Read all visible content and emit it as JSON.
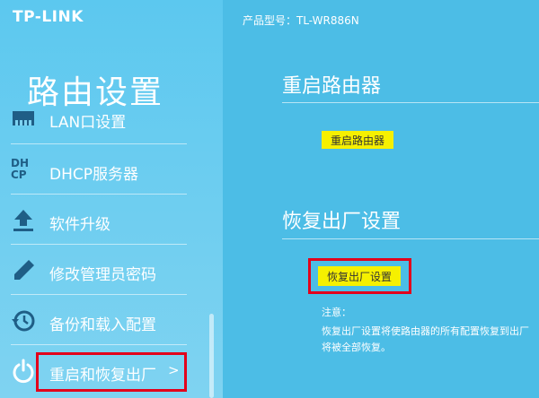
{
  "header": {
    "logo": "TP-LINK",
    "model_label": "产品型号：TL-WR886N"
  },
  "sidebar": {
    "title": "路由设置",
    "items": [
      {
        "label": "LAN口设置",
        "icon": "lan-icon"
      },
      {
        "label": "DHCP服务器",
        "icon": "dhcp-icon",
        "icon_text_top": "DH",
        "icon_text_bottom": "CP"
      },
      {
        "label": "软件升级",
        "icon": "upload-arrow-icon"
      },
      {
        "label": "修改管理员密码",
        "icon": "pencil-icon"
      },
      {
        "label": "备份和载入配置",
        "icon": "history-icon"
      },
      {
        "label": "重启和恢复出厂",
        "icon": "power-icon",
        "active": true,
        "arrow": ">"
      }
    ]
  },
  "main": {
    "reboot": {
      "title": "重启路由器",
      "button": "重启路由器"
    },
    "factory_reset": {
      "title": "恢复出厂设置",
      "button": "恢复出厂设置",
      "note_label": "注意：",
      "note_line1": "恢复出厂设置将使路由器的所有配置恢复到出厂",
      "note_line2": "将被全部恢复。"
    }
  },
  "colors": {
    "sidebar_bg": "#6fcef0",
    "main_bg": "#4cbde6",
    "button_yellow": "#f6f000",
    "highlight_red": "#e3001b"
  }
}
